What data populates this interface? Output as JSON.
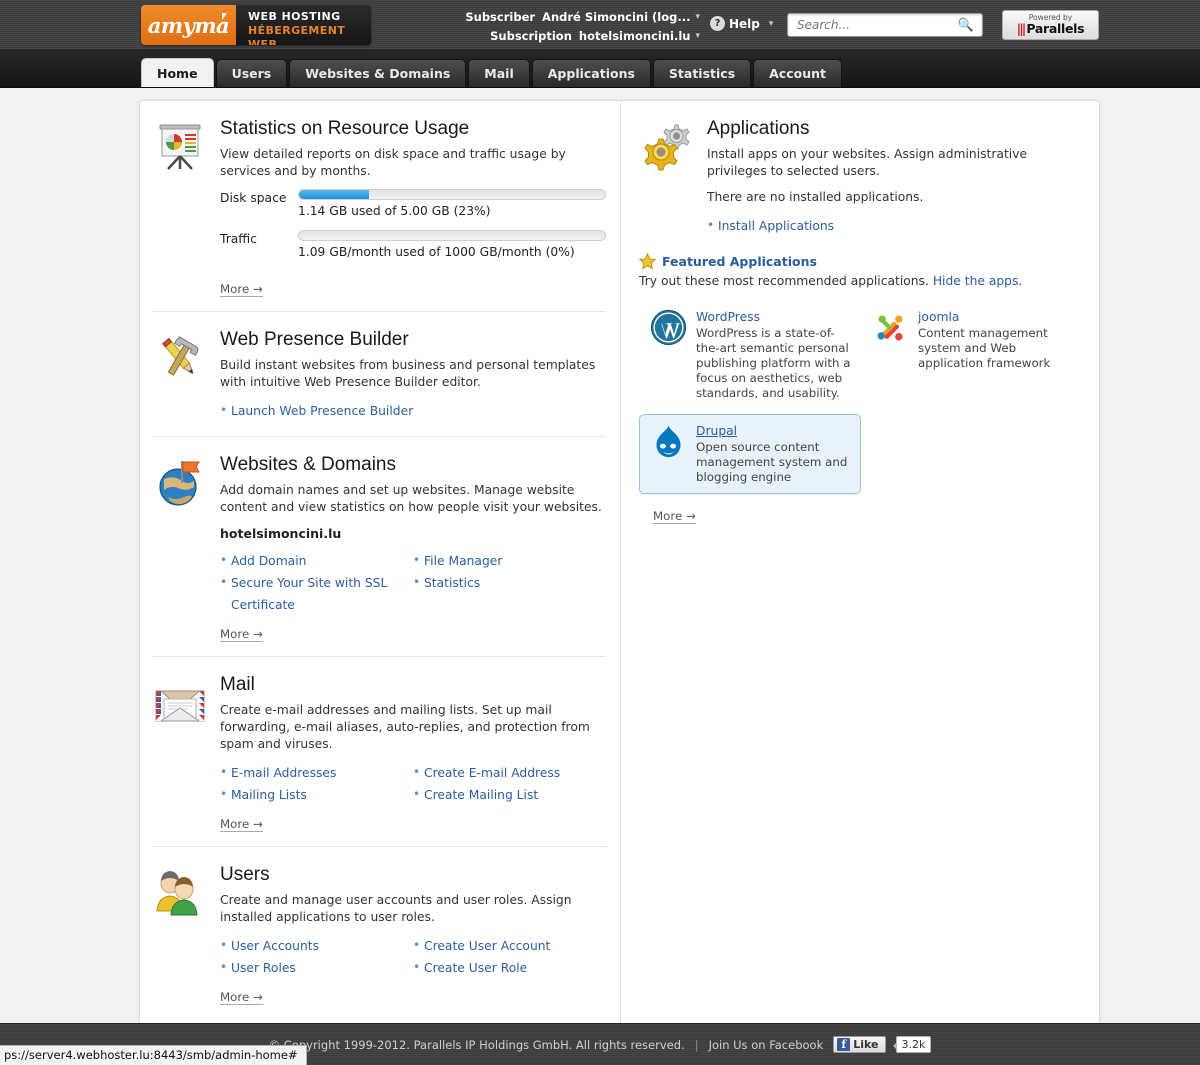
{
  "brand": {
    "logo_text": "amyma",
    "tagline_line1": "WEB HOSTING",
    "tagline_line2": "HÉBERGEMENT WEB",
    "accent_color": "#e8812a"
  },
  "header": {
    "subscriber_label": "Subscriber",
    "subscriber_value": "André Simoncini (log...",
    "subscription_label": "Subscription",
    "subscription_value": "hotelsimoncini.lu",
    "help_label": "Help",
    "help_icon": "question-circle-icon",
    "caret_icon": "chevron-down-icon"
  },
  "search": {
    "placeholder": "Search...",
    "value": "",
    "icon": "search-icon"
  },
  "powered_by": {
    "prefix": "Powered by",
    "name": "Parallels",
    "bars": "|||"
  },
  "nav": {
    "tabs": [
      {
        "label": "Home",
        "active": true
      },
      {
        "label": "Users",
        "active": false
      },
      {
        "label": "Websites & Domains",
        "active": false
      },
      {
        "label": "Mail",
        "active": false
      },
      {
        "label": "Applications",
        "active": false
      },
      {
        "label": "Statistics",
        "active": false
      },
      {
        "label": "Account",
        "active": false
      }
    ]
  },
  "left_column": {
    "statistics": {
      "title": "Statistics on Resource Usage",
      "icon": "presentation-chart-icon",
      "description": "View detailed reports on disk space and traffic usage by services and by months.",
      "meters": [
        {
          "label": "Disk space",
          "percent": 23,
          "value_text": "1.14 GB used of 5.00 GB (23%)"
        },
        {
          "label": "Traffic",
          "percent": 0,
          "value_text": "1.09 GB/month used of 1000 GB/month (0%)"
        }
      ],
      "more_label": "More →"
    },
    "web_presence_builder": {
      "title": "Web Presence Builder",
      "icon": "hammer-pencil-icon",
      "description": "Build instant websites from business and personal templates with intuitive Web Presence Builder editor.",
      "links": [
        "Launch Web Presence Builder"
      ]
    },
    "websites_domains": {
      "title": "Websites & Domains",
      "icon": "globe-flag-icon",
      "description": "Add domain names and set up websites. Manage website content and view statistics on how people visit your websites.",
      "domain": "hotelsimoncini.lu",
      "links_col1": [
        "Add Domain",
        "Secure Your Site with SSL Certificate"
      ],
      "links_col2": [
        "File Manager",
        "Statistics"
      ],
      "more_label": "More →"
    },
    "mail": {
      "title": "Mail",
      "icon": "envelope-icon",
      "description": "Create e-mail addresses and mailing lists. Set up mail forwarding, e-mail aliases, auto-replies, and protection from spam and viruses.",
      "links_col1": [
        "E-mail Addresses",
        "Mailing Lists"
      ],
      "links_col2": [
        "Create E-mail Address",
        "Create Mailing List"
      ],
      "more_label": "More →"
    },
    "users": {
      "title": "Users",
      "icon": "users-group-icon",
      "description": "Create and manage user accounts and user roles. Assign installed applications to user roles.",
      "links_col1": [
        "User Accounts",
        "User Roles"
      ],
      "links_col2": [
        "Create User Account",
        "Create User Role"
      ],
      "more_label": "More →"
    }
  },
  "right_column": {
    "applications": {
      "title": "Applications",
      "icon": "gears-icon",
      "description": "Install apps on your websites. Assign administrative privileges to selected users.",
      "status_text": "There are no installed applications.",
      "links": [
        "Install Applications"
      ]
    },
    "featured": {
      "icon": "star-icon",
      "title": "Featured Applications",
      "subtitle": "Try out these most recommended applications.",
      "hide_link": "Hide the apps.",
      "apps": [
        {
          "name": "WordPress",
          "icon": "wordpress-icon",
          "description": "WordPress is a state-of-the-art semantic personal publishing platform with a focus on aesthetics, web standards, and usability.",
          "selected": false
        },
        {
          "name": "joomla",
          "icon": "joomla-icon",
          "description": "Content management system and Web application framework",
          "selected": false
        },
        {
          "name": "Drupal",
          "icon": "drupal-icon",
          "description": "Open source content management system and blogging engine",
          "selected": true
        }
      ],
      "more_label": "More →"
    }
  },
  "footer": {
    "copyright": "© Copyright 1999-2012. Parallels IP Holdings GmbH. All rights reserved.",
    "separator": "|",
    "facebook_text": "Join Us on Facebook",
    "like_label": "Like",
    "like_count": "3.2k"
  },
  "statusbar": {
    "url": "ps://server4.webhoster.lu:8443/smb/admin-home#"
  }
}
